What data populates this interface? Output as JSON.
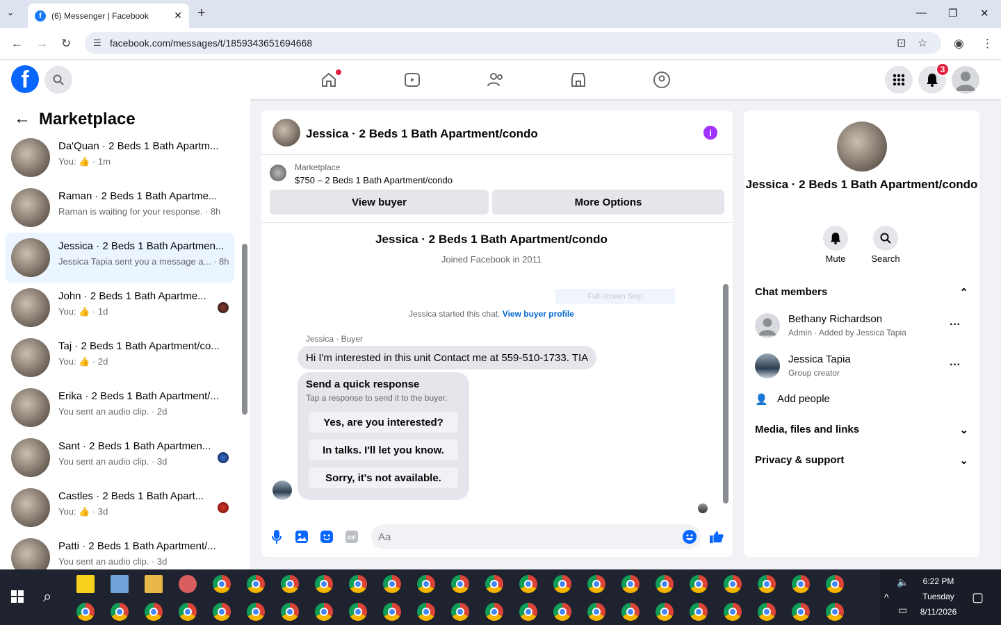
{
  "browser": {
    "tab_title": "(6) Messenger | Facebook",
    "url": "facebook.com/messages/t/1859343651694668"
  },
  "header": {
    "notifications_count": "3"
  },
  "left": {
    "title": "Marketplace",
    "conversations": [
      {
        "title": "Da'Quan · 2 Beds 1 Bath Apartm...",
        "sub": "You: 👍 · 1m"
      },
      {
        "title": "Raman · 2 Beds 1 Bath Apartme...",
        "sub": "Raman is waiting for your response. · 8h"
      },
      {
        "title": "Jessica · 2 Beds 1 Bath Apartmen...",
        "sub": "Jessica Tapia sent you a message a... · 8h"
      },
      {
        "title": "John · 2 Beds 1 Bath Apartme...",
        "sub": "You: 👍 · 1d"
      },
      {
        "title": "Taj · 2 Beds 1 Bath Apartment/co...",
        "sub": "You: 👍 · 2d"
      },
      {
        "title": "Erika · 2 Beds 1 Bath Apartment/...",
        "sub": "You sent an audio clip. · 2d"
      },
      {
        "title": "Sant · 2 Beds 1 Bath Apartmen...",
        "sub": "You sent an audio clip. · 3d"
      },
      {
        "title": "Castles · 2 Beds 1 Bath Apart...",
        "sub": "You: 👍 · 3d"
      },
      {
        "title": "Patti · 2 Beds 1 Bath Apartment/...",
        "sub": "You sent an audio clip. · 3d"
      }
    ]
  },
  "chat": {
    "title": "Jessica · 2 Beds 1 Bath Apartment/condo",
    "marketplace_label": "Marketplace",
    "listing": "$750 – 2 Beds 1 Bath Apartment/condo",
    "view_buyer": "View buyer",
    "more_options": "More Options",
    "profile_name": "Jessica · 2 Beds 1 Bath Apartment/condo",
    "joined": "Joined Facebook in 2011",
    "ghost": "Full-screen Snip",
    "started": "Jessica started this chat.",
    "view_profile": "View buyer profile",
    "sender": "Jessica · Buyer",
    "message": "Hi I'm interested in this unit Contact me at 559-510-1733. TIA",
    "quick_title": "Send a quick response",
    "quick_desc": "Tap a response to send it to the buyer.",
    "quick": [
      "Yes, are you interested?",
      "In talks. I'll let you know.",
      "Sorry, it's not available."
    ],
    "placeholder": "Aa"
  },
  "right": {
    "title": "Jessica · 2 Beds 1 Bath Apartment/condo",
    "mute": "Mute",
    "search": "Search",
    "chat_members": "Chat members",
    "members": [
      {
        "name": "Bethany Richardson",
        "role": "Admin · Added by Jessica Tapia"
      },
      {
        "name": "Jessica Tapia",
        "role": "Group creator"
      }
    ],
    "add_people": "Add people",
    "media": "Media, files and links",
    "privacy": "Privacy & support"
  },
  "tray": {
    "time": "6:22 PM",
    "day": "Tuesday",
    "date": "8/11/2026"
  }
}
